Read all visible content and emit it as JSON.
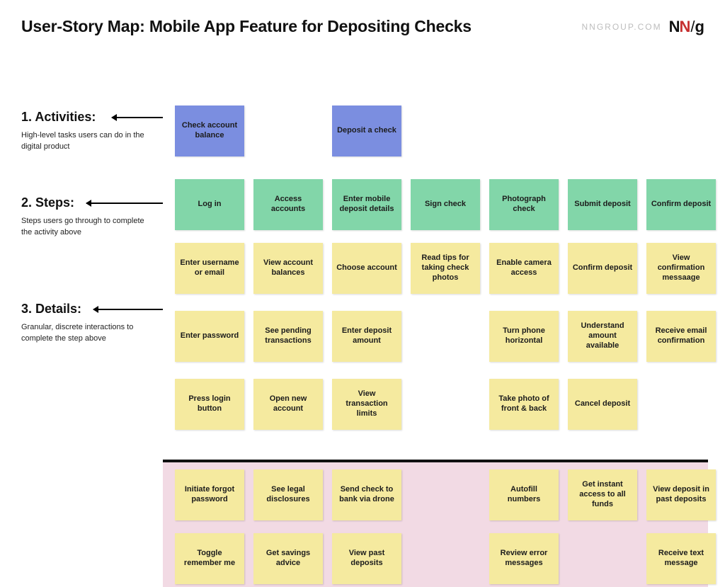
{
  "header": {
    "title": "User-Story Map: Mobile App Feature for Depositing Checks",
    "brand_text": "NNGROUP.COM"
  },
  "labels": {
    "activities": {
      "heading": "1. Activities:",
      "desc": "High-level tasks users can do in the digital product"
    },
    "steps": {
      "heading": "2. Steps:",
      "desc": "Steps users go through to complete the activity above"
    },
    "details": {
      "heading": "3. Details:",
      "desc": "Granular, discrete interactions to complete the step above"
    }
  },
  "activities": [
    "Check account balance",
    "Deposit a check"
  ],
  "steps": [
    "Log in",
    "Access accounts",
    "Enter mobile deposit details",
    "Sign check",
    "Photograph check",
    "Submit deposit",
    "Confirm deposit"
  ],
  "details": {
    "r1": [
      "Enter username or email",
      "View account balances",
      "Choose account",
      "Read tips for taking check photos",
      "Enable camera access",
      "Confirm deposit",
      "View confirmation messaage"
    ],
    "r2": [
      "Enter password",
      "See pending transactions",
      "Enter deposit amount",
      "",
      "Turn phone horizontal",
      "Understand amount available",
      "Receive email confirmation"
    ],
    "r3": [
      "Press login button",
      "Open new account",
      "View transaction limits",
      "",
      "Take photo of front & back",
      "Cancel deposit",
      ""
    ],
    "r4": [
      "Initiate forgot password",
      "See legal disclosures",
      "Send check to bank via drone",
      "",
      "Autofill numbers",
      "Get instant access to all funds",
      "View deposit in past deposits"
    ],
    "r5": [
      "Toggle remember me",
      "Get savings advice",
      "View past deposits",
      "",
      "Review error messages",
      "",
      "Receive text message"
    ]
  },
  "colors": {
    "activity": "#7b8ee0",
    "step": "#82d6a9",
    "detail": "#f5ea9f",
    "pink": "#f2dae4"
  }
}
